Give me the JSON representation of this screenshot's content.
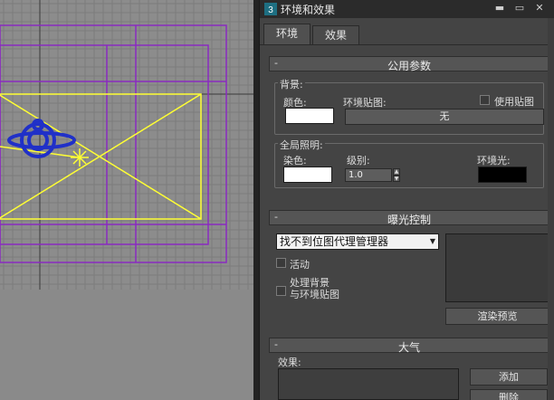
{
  "window": {
    "title": "环境和效果",
    "min": "▬",
    "max": "▭",
    "close": "✕"
  },
  "tabs": [
    {
      "label": "环境"
    },
    {
      "label": "效果"
    }
  ],
  "common_params": {
    "title": "公用参数",
    "collapse": "-",
    "background": {
      "group_label": "背景:",
      "color_label": "颜色:",
      "env_map_label": "环境贴图:",
      "use_map_label": "使用贴图",
      "map_button": "无"
    },
    "global_lighting": {
      "group_label": "全局照明:",
      "tint_label": "染色:",
      "level_label": "级别:",
      "level_value": "1.0",
      "ambient_label": "环境光:"
    }
  },
  "exposure": {
    "title": "曝光控制",
    "collapse": "-",
    "dropdown_value": "找不到位图代理管理器",
    "active_label": "活动",
    "process_bg_label_1": "处理背景",
    "process_bg_label_2": "与环境贴图",
    "render_preview_button": "渲染预览"
  },
  "atmosphere": {
    "title": "大气",
    "collapse": "-",
    "effects_label": "效果:",
    "add_button": "添加",
    "delete_button": "删除"
  },
  "colors": {
    "viewport_bg": "#8c8c8c",
    "grid": "#7a7a7a",
    "purple": "#8a2bc0",
    "yellow": "#ffff33",
    "blue_object": "#2030c8"
  }
}
